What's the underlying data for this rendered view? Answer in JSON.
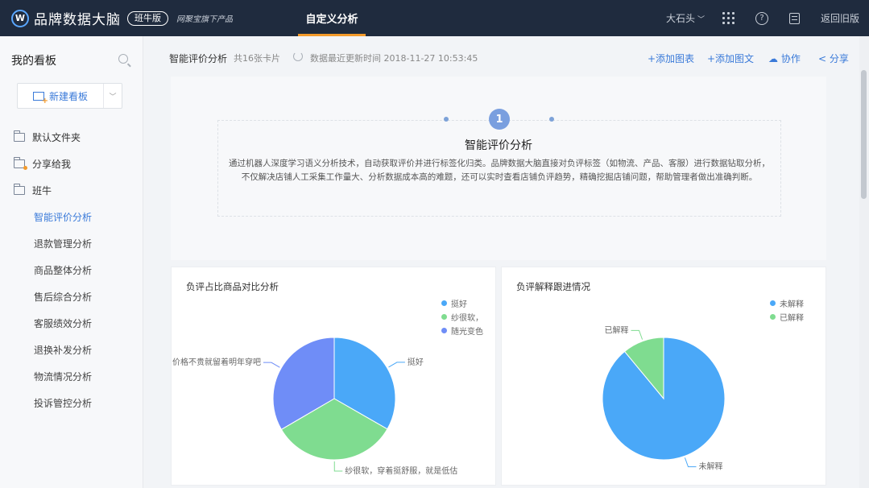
{
  "topbar": {
    "brand": "品牌数据大脑",
    "badge": "班牛版",
    "slogan": "网聚宝旗下产品",
    "active_tab": "自定义分析",
    "user": "大石头",
    "back_old": "返回旧版"
  },
  "sidebar": {
    "title": "我的看板",
    "new_board": "新建看板",
    "folders": [
      {
        "label": "默认文件夹"
      },
      {
        "label": "分享给我"
      },
      {
        "label": "班牛"
      }
    ],
    "items": [
      {
        "label": "智能评价分析",
        "active": true
      },
      {
        "label": "退款管理分析"
      },
      {
        "label": "商品整体分析"
      },
      {
        "label": "售后综合分析"
      },
      {
        "label": "客服绩效分析"
      },
      {
        "label": "退换补发分析"
      },
      {
        "label": "物流情况分析"
      },
      {
        "label": "投诉管控分析"
      }
    ]
  },
  "header": {
    "title": "智能评价分析",
    "count": "共16张卡片",
    "updated": "数据最近更新时间 2018-11-27 10:53:45",
    "actions": {
      "add_chart": "+添加图表",
      "add_text": "+添加图文",
      "collab": "协作",
      "share": "分享"
    }
  },
  "intro": {
    "step": "1",
    "title": "智能评价分析",
    "desc": "通过机器人深度学习语义分析技术，自动获取评价并进行标签化归类。品牌数据大脑直接对负评标签（如物流、产品、客服）进行数据钻取分析，不仅解决店铺人工采集工作量大、分析数据成本高的难题，还可以实时查看店铺负评趋势，精确挖掘店铺问题，帮助管理者做出准确判断。"
  },
  "chart_data": [
    {
      "type": "pie",
      "title": "负评占比商品对比分析",
      "legend": [
        "挺好",
        "纱很软，",
        "随光变色"
      ],
      "labels": [
        "挺好",
        "纱很软，穿着挺舒服，就是低估",
        "价格不贵就留着明年穿吧"
      ],
      "values": [
        33.3,
        33.3,
        33.4
      ],
      "colors": [
        "#4aa8f8",
        "#7fdc90",
        "#6f8df7"
      ]
    },
    {
      "type": "pie",
      "title": "负评解释跟进情况",
      "legend": [
        "未解释",
        "已解释"
      ],
      "labels": [
        "未解释",
        "已解释"
      ],
      "values": [
        89,
        11
      ],
      "colors": [
        "#4aa8f8",
        "#7fdc90"
      ]
    }
  ]
}
